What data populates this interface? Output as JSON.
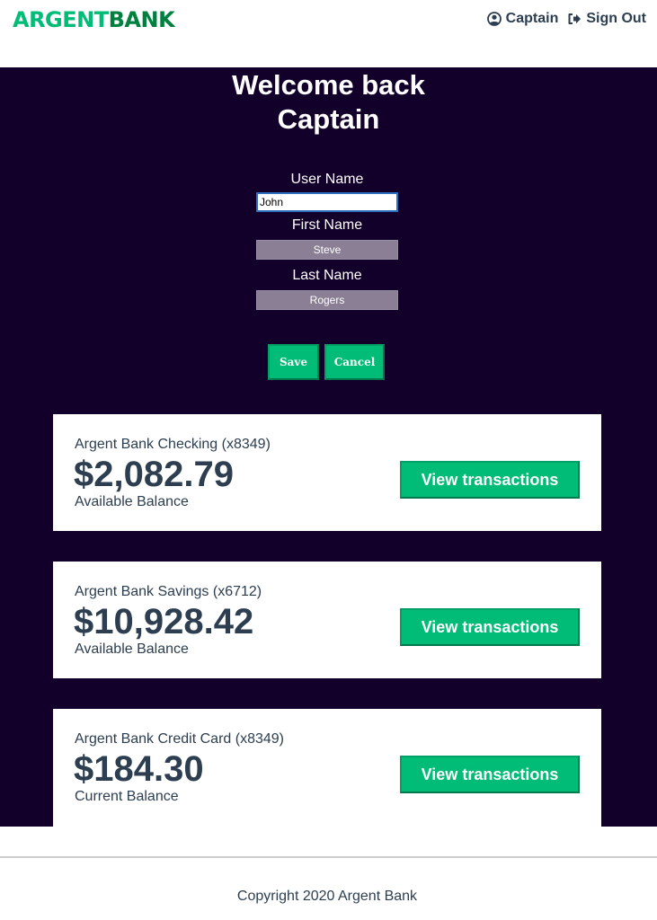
{
  "header": {
    "logo_part1": "ARGENT",
    "logo_part2": "BANK",
    "user_label": "Captain",
    "signout_label": "Sign Out"
  },
  "welcome": {
    "line1": "Welcome back",
    "line2": "Captain"
  },
  "form": {
    "user_name_label": "User Name",
    "user_name_value": "John",
    "first_name_label": "First Name",
    "first_name_value": "Steve",
    "last_name_label": "Last Name",
    "last_name_value": "Rogers",
    "save_label": "Save",
    "cancel_label": "Cancel"
  },
  "accounts": [
    {
      "title": "Argent Bank Checking (x8349)",
      "amount": "$2,082.79",
      "description": "Available Balance",
      "button": "View transactions"
    },
    {
      "title": "Argent Bank Savings (x6712)",
      "amount": "$10,928.42",
      "description": "Available Balance",
      "button": "View transactions"
    },
    {
      "title": "Argent Bank Credit Card (x8349)",
      "amount": "$184.30",
      "description": "Current Balance",
      "button": "View transactions"
    }
  ],
  "footer": {
    "copyright": "Copyright 2020 Argent Bank"
  },
  "colors": {
    "brand_green": "#00bc77",
    "brand_dark_green": "#00803f",
    "main_background": "#12002b",
    "text": "#2c3e50"
  },
  "icons": {
    "user": "user-circle-icon",
    "signout": "sign-out-icon"
  }
}
